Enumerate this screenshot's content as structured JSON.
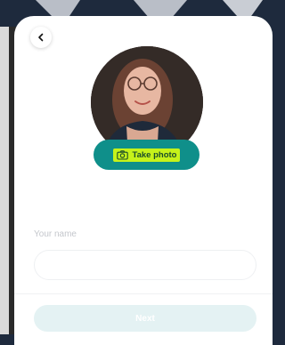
{
  "header": {
    "back_icon": "chevron-left-icon"
  },
  "profile": {
    "photo_alt": "User profile photo",
    "take_photo_label": "Take photo",
    "camera_icon": "camera-icon",
    "highlight_color": "#c6f21a",
    "button_color": "#0f8f8a"
  },
  "form": {
    "name_label": "Your name",
    "name_value": "",
    "name_placeholder": ""
  },
  "footer": {
    "next_label": "Next",
    "next_color": "#e4f2f3"
  }
}
